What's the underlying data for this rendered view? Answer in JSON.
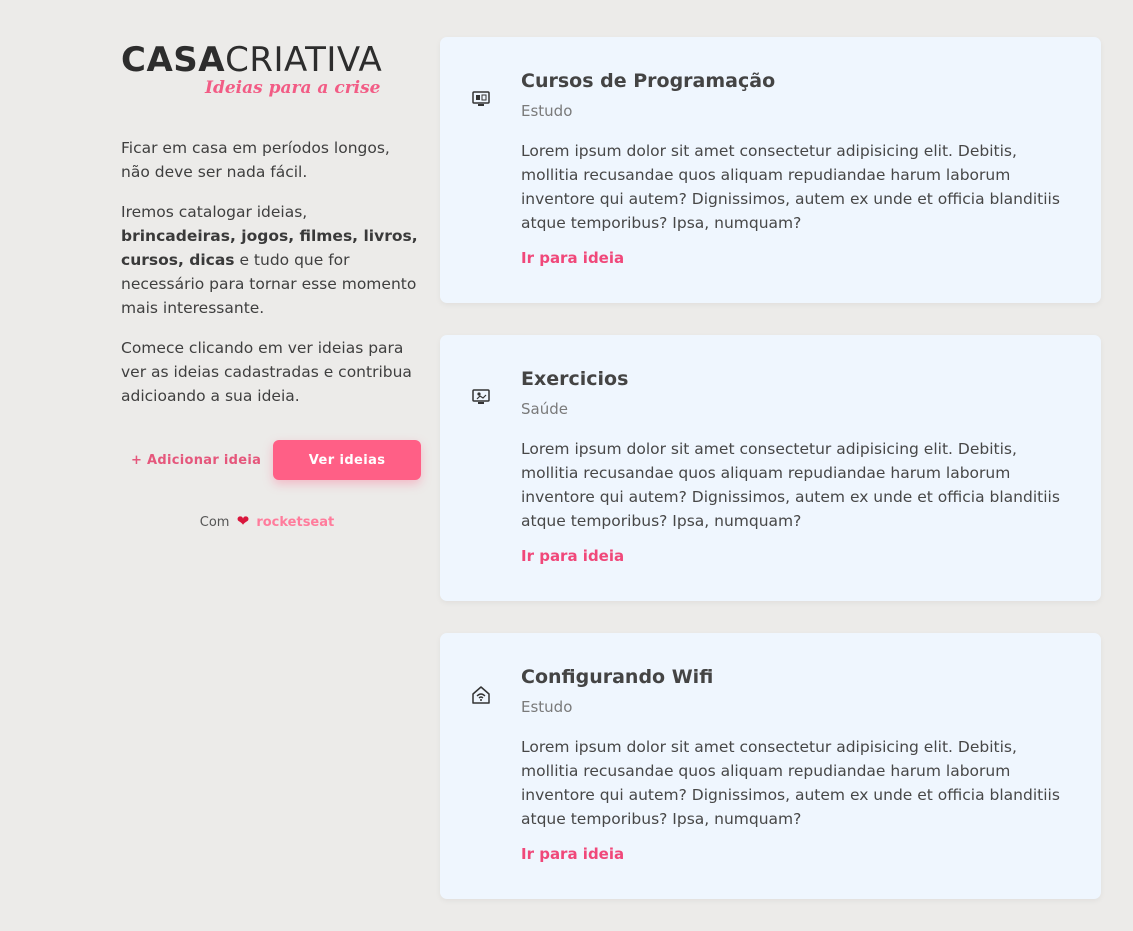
{
  "brand": {
    "logo_bold": "CASA",
    "logo_light": "CRIATIVA",
    "tagline": "Ideias para a crise"
  },
  "intro": {
    "p1": "Ficar em casa em períodos longos, não deve ser nada fácil.",
    "p2_before": "Iremos catalogar ideias, ",
    "p2_bold": "brincadeiras, jogos, filmes, livros, cursos, dicas",
    "p2_after": " e tudo que for necessário para tornar esse momento mais interessante.",
    "p3": "Comece clicando em ver ideias para ver as ideias cadastradas e contribua adicioando a sua ideia."
  },
  "actions": {
    "add_label": "+ Adicionar ideia",
    "view_label": "Ver ideias"
  },
  "credit": {
    "prefix": "Com",
    "brand": "rocketseat"
  },
  "colors": {
    "accent": "#ff5f86",
    "link": "#f0487a",
    "card_bg": "#eff6fe",
    "page_bg": "#ecebe9"
  },
  "cards": [
    {
      "icon": "computer-icon",
      "title": "Cursos de Programação",
      "category": "Estudo",
      "description": "Lorem ipsum dolor sit amet consectetur adipisicing elit. Debitis, mollitia recusandae quos aliquam repudiandae harum laborum inventore qui autem? Dignissimos, autem ex unde et officia blanditiis atque temporibus? Ipsa, numquam?",
      "link": "Ir para ideia"
    },
    {
      "icon": "exercise-video-icon",
      "title": "Exercicios",
      "category": "Saúde",
      "description": "Lorem ipsum dolor sit amet consectetur adipisicing elit. Debitis, mollitia recusandae quos aliquam repudiandae harum laborum inventore qui autem? Dignissimos, autem ex unde et officia blanditiis atque temporibus? Ipsa, numquam?",
      "link": "Ir para ideia"
    },
    {
      "icon": "wifi-home-icon",
      "title": "Configurando Wifi",
      "category": "Estudo",
      "description": "Lorem ipsum dolor sit amet consectetur adipisicing elit. Debitis, mollitia recusandae quos aliquam repudiandae harum laborum inventore qui autem? Dignissimos, autem ex unde et officia blanditiis atque temporibus? Ipsa, numquam?",
      "link": "Ir para ideia"
    }
  ]
}
